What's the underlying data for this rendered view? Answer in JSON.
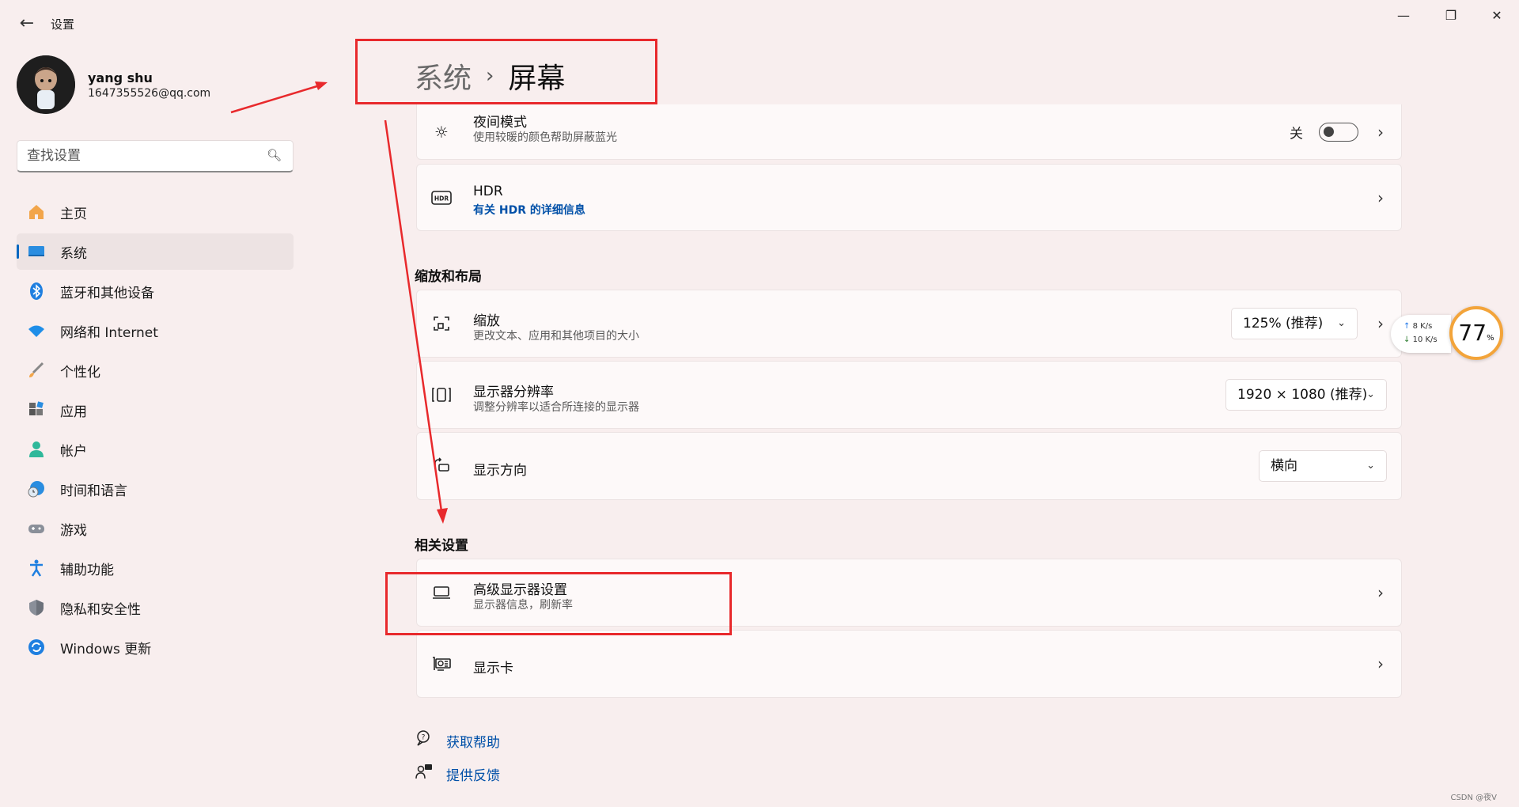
{
  "window": {
    "title": "设置",
    "back_icon": "back-arrow-icon",
    "controls": [
      "minimize-icon",
      "restore-icon",
      "close-icon"
    ]
  },
  "profile": {
    "name": "yang shu",
    "email": "1647355526@qq.com"
  },
  "search": {
    "placeholder": "查找设置"
  },
  "sidebar": {
    "items": [
      {
        "label": "主页",
        "icon": "home-icon",
        "active": false
      },
      {
        "label": "系统",
        "icon": "system-icon",
        "active": true
      },
      {
        "label": "蓝牙和其他设备",
        "icon": "bluetooth-icon",
        "active": false
      },
      {
        "label": "网络和 Internet",
        "icon": "wifi-icon",
        "active": false
      },
      {
        "label": "个性化",
        "icon": "brush-icon",
        "active": false
      },
      {
        "label": "应用",
        "icon": "apps-icon",
        "active": false
      },
      {
        "label": "帐户",
        "icon": "account-icon",
        "active": false
      },
      {
        "label": "时间和语言",
        "icon": "clock-globe-icon",
        "active": false
      },
      {
        "label": "游戏",
        "icon": "gamepad-icon",
        "active": false
      },
      {
        "label": "辅助功能",
        "icon": "accessibility-icon",
        "active": false
      },
      {
        "label": "隐私和安全性",
        "icon": "shield-icon",
        "active": false
      },
      {
        "label": "Windows 更新",
        "icon": "update-icon",
        "active": false
      }
    ]
  },
  "breadcrumb": {
    "parent": "系统",
    "separator": "›",
    "current": "屏幕"
  },
  "cards": {
    "night_light": {
      "title": "夜间模式",
      "subtitle": "使用较暖的颜色帮助屏蔽蓝光",
      "toggle_label": "关",
      "toggle_on": false,
      "icon": "brightness-icon"
    },
    "hdr": {
      "title": "HDR",
      "link": "有关 HDR 的详细信息",
      "icon": "hdr-icon"
    },
    "scale": {
      "title": "缩放",
      "subtitle": "更改文本、应用和其他项目的大小",
      "value": "125% (推荐)",
      "icon": "scale-icon"
    },
    "resolution": {
      "title": "显示器分辨率",
      "subtitle": "调整分辨率以适合所连接的显示器",
      "value": "1920 × 1080 (推荐)",
      "icon": "resolution-icon"
    },
    "orientation": {
      "title": "显示方向",
      "value": "横向",
      "icon": "rotate-icon"
    },
    "advanced": {
      "title": "高级显示器设置",
      "subtitle": "显示器信息，刷新率",
      "icon": "monitor-icon"
    },
    "gpu": {
      "title": "显示卡",
      "icon": "gpu-icon"
    }
  },
  "sections": {
    "scale_layout": "缩放和布局",
    "related": "相关设置"
  },
  "help": {
    "get_help": "获取帮助",
    "feedback": "提供反馈"
  },
  "widget": {
    "up_speed": "8",
    "down_speed": "10",
    "unit": "K/s",
    "percent": "77",
    "percent_sign": "%"
  },
  "annotation_colors": {
    "red": "#e8292c"
  },
  "watermark": "CSDN @夜V"
}
